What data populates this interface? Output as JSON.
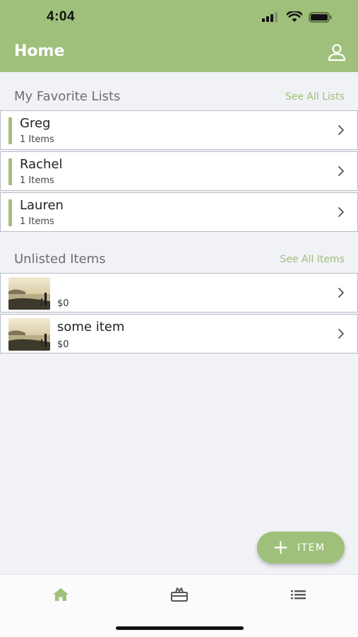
{
  "status": {
    "time": "4:04"
  },
  "header": {
    "title": "Home"
  },
  "favorites": {
    "title": "My Favorite Lists",
    "see_all": "See All Lists",
    "items": [
      {
        "name": "Greg",
        "count": "1 Items"
      },
      {
        "name": "Rachel",
        "count": "1 Items"
      },
      {
        "name": "Lauren",
        "count": "1 Items"
      }
    ]
  },
  "unlisted": {
    "title": "Unlisted Items",
    "see_all": "See All Items",
    "items": [
      {
        "name": "",
        "price": "$0"
      },
      {
        "name": "some item",
        "price": "$0"
      }
    ]
  },
  "fab": {
    "label": "ITEM"
  },
  "tabs": [
    "home-icon",
    "gift-icon",
    "list-icon"
  ],
  "colors": {
    "accent": "#9fc07a",
    "background": "#f1f2f6"
  }
}
